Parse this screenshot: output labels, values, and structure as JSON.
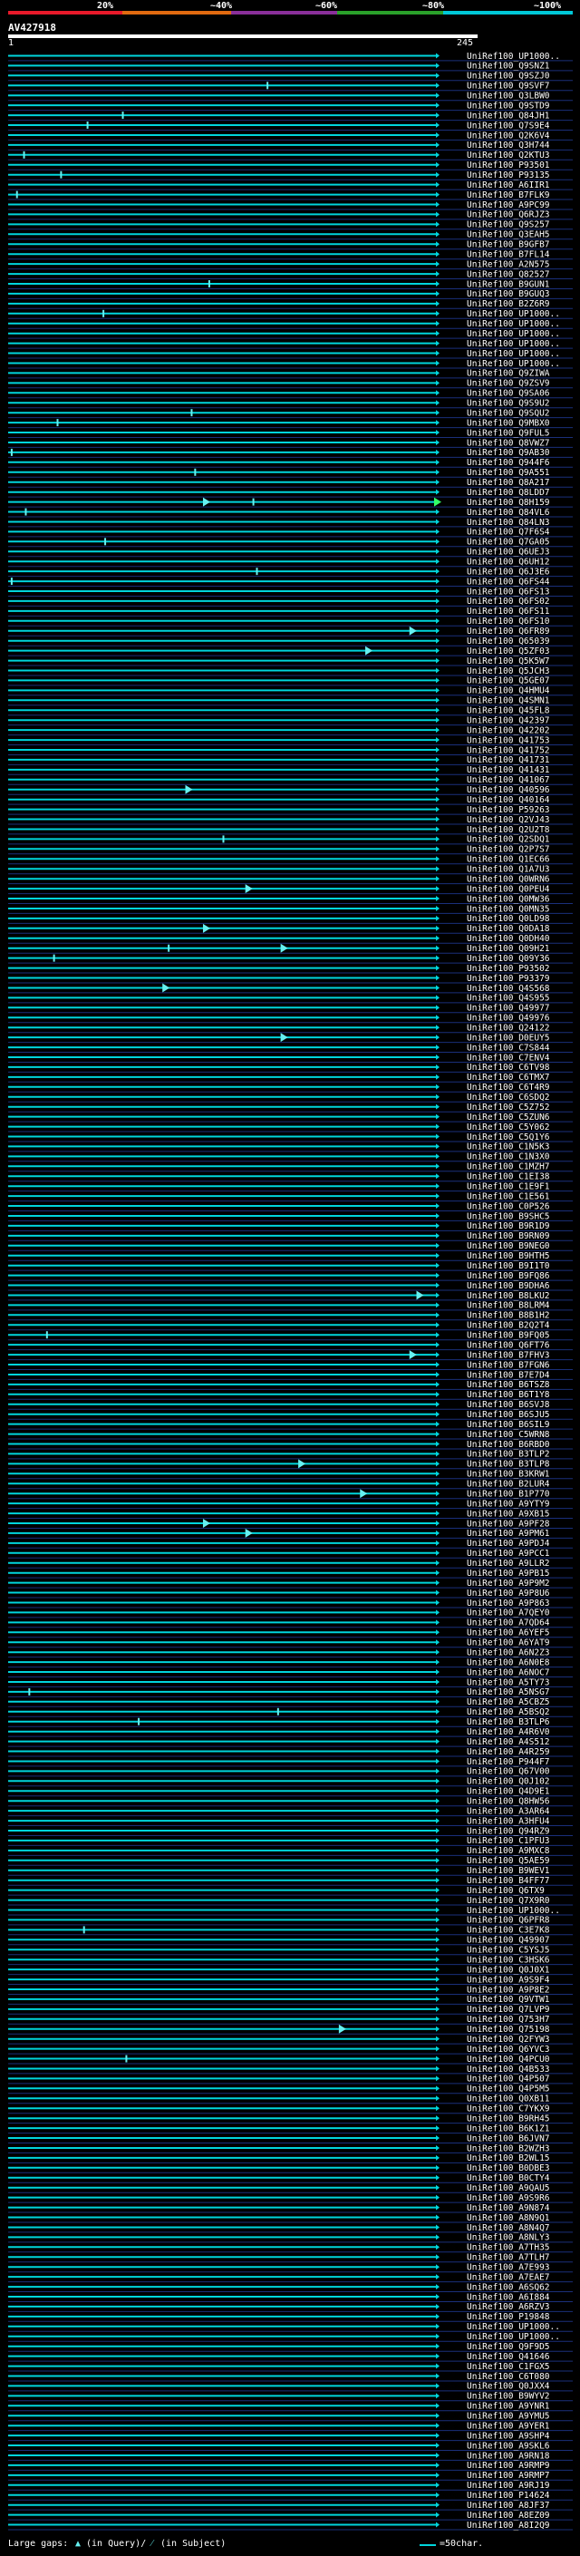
{
  "scale": {
    "labels": [
      "20%",
      "~40%",
      "~60%",
      "~80%",
      "~100%"
    ],
    "colors": [
      "#e8192a",
      "#e06a10",
      "#8a2f9a",
      "#2aa12a",
      "#00c8d8"
    ]
  },
  "query": {
    "name": "AV427918",
    "start_label": "1",
    "end_label": "245"
  },
  "footer": {
    "large_gaps": "Large gaps:",
    "in_query": "(in Query)/",
    "in_subject": "(in Subject)",
    "scale_note": "=50char."
  },
  "colors": {
    "hit_line": "#00d5dc",
    "grid_line": "#1a2f7a",
    "gap_marker": "#66f0f0",
    "gap_marker_alt": "#33ff66",
    "background": "#000000"
  },
  "chart_data": {
    "type": "alignment",
    "title": "AV427918",
    "xlim": [
      1,
      245
    ],
    "subjects": [
      "UniRef100_UP1000..",
      "UniRef100_Q9SNZ1",
      "UniRef100_Q9SZJ0",
      "UniRef100_Q9SVF7",
      "UniRef100_Q3LBW0",
      "UniRef100_Q9STD9",
      "UniRef100_Q84JH1",
      "UniRef100_Q7S9E4",
      "UniRef100_Q2K6V4",
      "UniRef100_Q3H744",
      "UniRef100_Q2KTU3",
      "UniRef100_P93501",
      "UniRef100_P93135",
      "UniRef100_A6IIR1",
      "UniRef100_B7FLK9",
      "UniRef100_A9PC99",
      "UniRef100_Q6RJZ3",
      "UniRef100_Q9S257",
      "UniRef100_Q3EAH5",
      "UniRef100_B9GFB7",
      "UniRef100_B7FL14",
      "UniRef100_A2N575",
      "UniRef100_Q82527",
      "UniRef100_B9GUN1",
      "UniRef100_B9GUQ3",
      "UniRef100_B2Z6R9",
      "UniRef100_UP1000..",
      "UniRef100_UP1000..",
      "UniRef100_UP1000..",
      "UniRef100_UP1000..",
      "UniRef100_UP1000..",
      "UniRef100_UP1000..",
      "UniRef100_Q9ZIWA",
      "UniRef100_Q9ZSV9",
      "UniRef100_Q9SA06",
      "UniRef100_Q9S9U2",
      "UniRef100_Q9SQU2",
      "UniRef100_Q9MBX0",
      "UniRef100_Q9FUL5",
      "UniRef100_Q8VWZ7",
      "UniRef100_Q9AB30",
      "UniRef100_Q944F6",
      "UniRef100_Q9A551",
      "UniRef100_Q8A217",
      "UniRef100_Q8LDD7",
      "UniRef100_Q8H159",
      "UniRef100_Q84VL6",
      "UniRef100_Q84LN3",
      "UniRef100_Q7F6S4",
      "UniRef100_Q7GA05",
      "UniRef100_Q6UEJ3",
      "UniRef100_Q6UH12",
      "UniRef100_Q6J3E6",
      "UniRef100_Q6FS44",
      "UniRef100_Q6FS13",
      "UniRef100_Q6FS02",
      "UniRef100_Q6FS11",
      "UniRef100_Q6FS10",
      "UniRef100_Q6FR89",
      "UniRef100_Q65039",
      "UniRef100_Q5ZF03",
      "UniRef100_Q5K5W7",
      "UniRef100_Q5JCH3",
      "UniRef100_Q5GE07",
      "UniRef100_Q4HMU4",
      "UniRef100_Q4SMN1",
      "UniRef100_Q45FL8",
      "UniRef100_Q42397",
      "UniRef100_Q42202",
      "UniRef100_Q41753",
      "UniRef100_Q41752",
      "UniRef100_Q41731",
      "UniRef100_Q41431",
      "UniRef100_Q41067",
      "UniRef100_Q40596",
      "UniRef100_Q40164",
      "UniRef100_P59263",
      "UniRef100_Q2VJ43",
      "UniRef100_Q2U2T8",
      "UniRef100_Q2SDQ1",
      "UniRef100_Q2P7S7",
      "UniRef100_Q1EC66",
      "UniRef100_Q1A7U3",
      "UniRef100_Q0WRN6",
      "UniRef100_Q0PEU4",
      "UniRef100_Q0MW36",
      "UniRef100_Q0MN35",
      "UniRef100_Q0LD98",
      "UniRef100_Q0DA18",
      "UniRef100_Q0DH40",
      "UniRef100_Q09H21",
      "UniRef100_Q09Y36",
      "UniRef100_P93502",
      "UniRef100_P93379",
      "UniRef100_Q4S568",
      "UniRef100_Q4S955",
      "UniRef100_Q49977",
      "UniRef100_Q49976",
      "UniRef100_Q24122",
      "UniRef100_D0EUY5",
      "UniRef100_C7S844",
      "UniRef100_C7ENV4",
      "UniRef100_C6TV98",
      "UniRef100_C6TMX7",
      "UniRef100_C6T4R9",
      "UniRef100_C6SDQ2",
      "UniRef100_C5Z752",
      "UniRef100_C5ZUN6",
      "UniRef100_C5Y062",
      "UniRef100_C5Q1Y6",
      "UniRef100_C1N5K3",
      "UniRef100_C1N3X0",
      "UniRef100_C1MZH7",
      "UniRef100_C1EI38",
      "UniRef100_C1E9F1",
      "UniRef100_C1E561",
      "UniRef100_C0P526",
      "UniRef100_B9SHC5",
      "UniRef100_B9R1D9",
      "UniRef100_B9RN09",
      "UniRef100_B9NEG0",
      "UniRef100_B9HTH5",
      "UniRef100_B9I1T0",
      "UniRef100_B9FQ86",
      "UniRef100_B9DHA6",
      "UniRef100_B8LKU2",
      "UniRef100_B8LRM4",
      "UniRef100_B8B1H2",
      "UniRef100_B2Q2T4",
      "UniRef100_B9FQ05",
      "UniRef100_Q6FT76",
      "UniRef100_B7FHV3",
      "UniRef100_B7FGN6",
      "UniRef100_B7E7D4",
      "UniRef100_B6TSZ8",
      "UniRef100_B6T1Y8",
      "UniRef100_B6SVJ8",
      "UniRef100_B6SJU5",
      "UniRef100_B6SIL9",
      "UniRef100_C5WRN8",
      "UniRef100_B6RBD0",
      "UniRef100_B3TLP2",
      "UniRef100_B3TLP8",
      "UniRef100_B3KRW1",
      "UniRef100_B2LUR4",
      "UniRef100_B1P770",
      "UniRef100_A9YTY9",
      "UniRef100_A9XB15",
      "UniRef100_A9PF28",
      "UniRef100_A9PM61",
      "UniRef100_A9PDJ4",
      "UniRef100_A9PCC1",
      "UniRef100_A9LLR2",
      "UniRef100_A9PB15",
      "UniRef100_A9P9M2",
      "UniRef100_A9P8U6",
      "UniRef100_A9P863",
      "UniRef100_A7QEY0",
      "UniRef100_A7QD64",
      "UniRef100_A6YEF5",
      "UniRef100_A6YAT9",
      "UniRef100_A6N2Z3",
      "UniRef100_A6N0E8",
      "UniRef100_A6NOC7",
      "UniRef100_A5TY73",
      "UniRef100_A5NSG7",
      "UniRef100_A5CBZ5",
      "UniRef100_A5BSQ2",
      "UniRef100_B3TLP6",
      "UniRef100_A4R6V0",
      "UniRef100_A4S512",
      "UniRef100_A4R259",
      "UniRef100_P944F7",
      "UniRef100_Q67V00",
      "UniRef100_Q0J102",
      "UniRef100_Q4D9E1",
      "UniRef100_Q8HW56",
      "UniRef100_A3AR64",
      "UniRef100_A3HFU4",
      "UniRef100_Q94RZ9",
      "UniRef100_C1PFU3",
      "UniRef100_A9MXC8",
      "UniRef100_Q5AE59",
      "UniRef100_B9WEV1",
      "UniRef100_B4FF77",
      "UniRef100_Q6TX9",
      "UniRef100_Q7X9R0",
      "UniRef100_UP1000..",
      "UniRef100_Q6PFR8",
      "UniRef100_C3E7K8",
      "UniRef100_Q49907",
      "UniRef100_C5YSJ5",
      "UniRef100_C3HSK6",
      "UniRef100_Q0J0X1",
      "UniRef100_A9S9F4",
      "UniRef100_A9P8E2",
      "UniRef100_Q9VTW1",
      "UniRef100_Q7LVP9",
      "UniRef100_Q753H7",
      "UniRef100_Q75198",
      "UniRef100_Q2FYW3",
      "UniRef100_Q6YVC3",
      "UniRef100_Q4PCU0",
      "UniRef100_Q4B533",
      "UniRef100_Q4P507",
      "UniRef100_Q4P5M5",
      "UniRef100_Q0XB11",
      "UniRef100_C7YKX9",
      "UniRef100_B9RH45",
      "UniRef100_B6K1Z1",
      "UniRef100_B6JVN7",
      "UniRef100_B2WZH3",
      "UniRef100_B2WL15",
      "UniRef100_B0DBE3",
      "UniRef100_B0CTY4",
      "UniRef100_A9QAU5",
      "UniRef100_A9S9R6",
      "UniRef100_A9N874",
      "UniRef100_A8N9Q1",
      "UniRef100_A8N4Q7",
      "UniRef100_A8NLY3",
      "UniRef100_A7TH35",
      "UniRef100_A7TLH7",
      "UniRef100_A7E993",
      "UniRef100_A7EAE7",
      "UniRef100_A6SQ62",
      "UniRef100_A6I884",
      "UniRef100_A6RZV3",
      "UniRef100_P19848",
      "UniRef100_UP1000..",
      "UniRef100_UP1000..",
      "UniRef100_Q9F9D5",
      "UniRef100_Q41646",
      "UniRef100_C1FGX5",
      "UniRef100_C6T080",
      "UniRef100_Q0JXX4",
      "UniRef100_B9WYV2",
      "UniRef100_A9YNR1",
      "UniRef100_A9YMU5",
      "UniRef100_A9YER1",
      "UniRef100_A9SHP4",
      "UniRef100_A9SKL6",
      "UniRef100_A9RN18",
      "UniRef100_A9RMP9",
      "UniRef100_A9RMP7",
      "UniRef100_A9RJ19",
      "UniRef100_P14624",
      "UniRef100_A8JF37",
      "UniRef100_A8EZ09",
      "UniRef100_A8I2Q9"
    ],
    "alignment": {
      "query_start": 1,
      "query_end": 245,
      "subject_start": 1,
      "subject_end": 245
    },
    "gaps": [
      {
        "row": 3,
        "pos": 148,
        "kind": "subject"
      },
      {
        "row": 6,
        "pos": 66,
        "kind": "subject"
      },
      {
        "row": 7,
        "pos": 46,
        "kind": "subject"
      },
      {
        "row": 10,
        "pos": 10,
        "kind": "subject"
      },
      {
        "row": 12,
        "pos": 31,
        "kind": "subject"
      },
      {
        "row": 14,
        "pos": 6,
        "kind": "subject"
      },
      {
        "row": 23,
        "pos": 115,
        "kind": "subject"
      },
      {
        "row": 26,
        "pos": 55,
        "kind": "subject"
      },
      {
        "row": 36,
        "pos": 105,
        "kind": "subject"
      },
      {
        "row": 37,
        "pos": 29,
        "kind": "subject"
      },
      {
        "row": 40,
        "pos": 3,
        "kind": "subject"
      },
      {
        "row": 42,
        "pos": 107,
        "kind": "subject"
      },
      {
        "row": 45,
        "pos": 114,
        "kind": "query"
      },
      {
        "row": 45,
        "pos": 140,
        "kind": "subject"
      },
      {
        "row": 45,
        "pos": 245,
        "kind": "query_alt"
      },
      {
        "row": 46,
        "pos": 11,
        "kind": "subject"
      },
      {
        "row": 49,
        "pos": 56,
        "kind": "subject"
      },
      {
        "row": 52,
        "pos": 142,
        "kind": "subject"
      },
      {
        "row": 53,
        "pos": 3,
        "kind": "subject"
      },
      {
        "row": 58,
        "pos": 231,
        "kind": "query"
      },
      {
        "row": 60,
        "pos": 206,
        "kind": "query"
      },
      {
        "row": 74,
        "pos": 104,
        "kind": "query"
      },
      {
        "row": 79,
        "pos": 123,
        "kind": "subject"
      },
      {
        "row": 84,
        "pos": 138,
        "kind": "query"
      },
      {
        "row": 88,
        "pos": 114,
        "kind": "query"
      },
      {
        "row": 90,
        "pos": 92,
        "kind": "subject"
      },
      {
        "row": 90,
        "pos": 158,
        "kind": "query"
      },
      {
        "row": 91,
        "pos": 27,
        "kind": "subject"
      },
      {
        "row": 94,
        "pos": 91,
        "kind": "query"
      },
      {
        "row": 99,
        "pos": 158,
        "kind": "query"
      },
      {
        "row": 125,
        "pos": 235,
        "kind": "query"
      },
      {
        "row": 129,
        "pos": 23,
        "kind": "subject"
      },
      {
        "row": 131,
        "pos": 231,
        "kind": "query"
      },
      {
        "row": 142,
        "pos": 168,
        "kind": "query"
      },
      {
        "row": 145,
        "pos": 203,
        "kind": "query"
      },
      {
        "row": 148,
        "pos": 114,
        "kind": "query"
      },
      {
        "row": 149,
        "pos": 138,
        "kind": "query"
      },
      {
        "row": 165,
        "pos": 13,
        "kind": "subject"
      },
      {
        "row": 167,
        "pos": 154,
        "kind": "subject"
      },
      {
        "row": 168,
        "pos": 75,
        "kind": "subject"
      },
      {
        "row": 189,
        "pos": 44,
        "kind": "subject"
      },
      {
        "row": 199,
        "pos": 191,
        "kind": "query"
      },
      {
        "row": 202,
        "pos": 68,
        "kind": "subject"
      }
    ]
  }
}
